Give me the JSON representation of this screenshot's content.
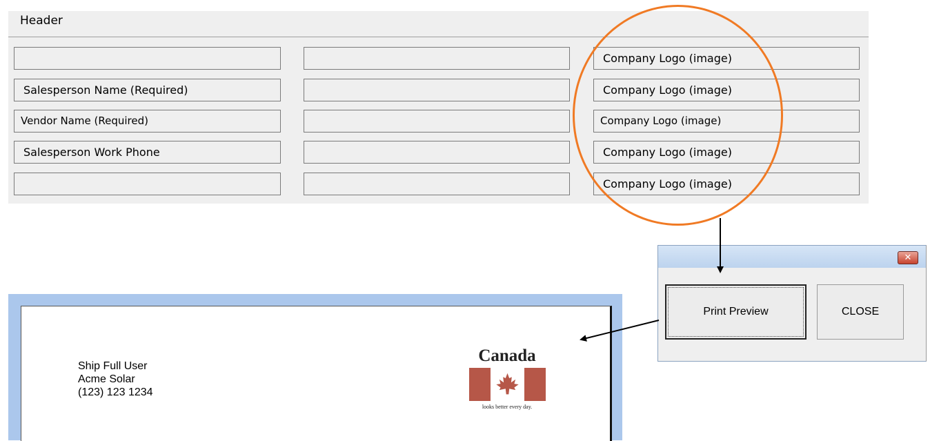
{
  "header_panel": {
    "title": "Header",
    "rows": [
      {
        "col1": "",
        "col2": "",
        "col3": "Company Logo (image)"
      },
      {
        "col1": "Salesperson Name  (Required)",
        "col2": "",
        "col3": "Company Logo (image)"
      },
      {
        "col1": "Vendor Name  (Required)",
        "col2": "",
        "col3": "Company Logo (image)"
      },
      {
        "col1": "Salesperson Work Phone",
        "col2": "",
        "col3": "Company Logo (image)"
      },
      {
        "col1": "",
        "col2": "",
        "col3": "Company Logo (image)"
      }
    ]
  },
  "dialog": {
    "close_glyph": "✕",
    "print_preview_label": "Print Preview",
    "close_label": "CLOSE"
  },
  "print_preview": {
    "address_lines": [
      "Ship Full User",
      "Acme Solar",
      "(123) 123 1234"
    ],
    "logo": {
      "wordmark": "Canada",
      "tagline": "looks better every day."
    }
  },
  "colors": {
    "highlight": "#f07a24",
    "flag_red": "#b65748",
    "preview_frame": "#abc7ec"
  }
}
